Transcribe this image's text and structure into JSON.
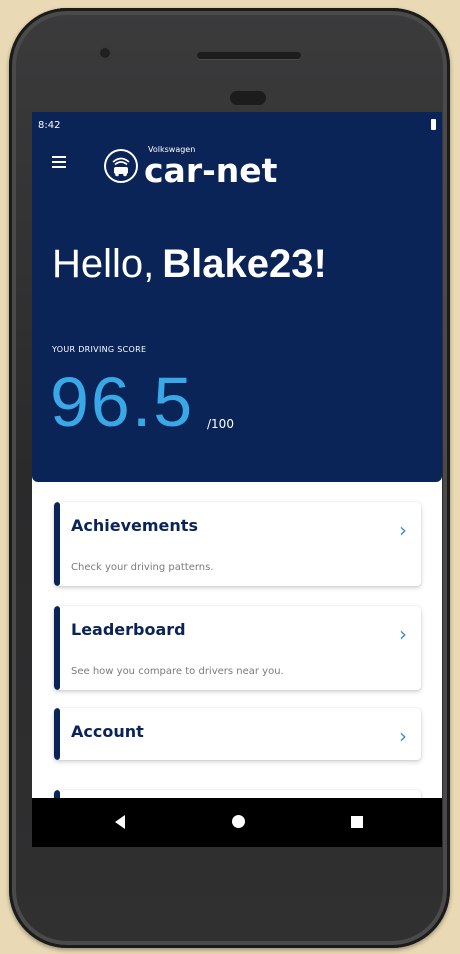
{
  "status_bar": {
    "time": "8:42"
  },
  "app": {
    "brand": "Volkswagen",
    "name": "car-net"
  },
  "greeting": {
    "hello": "Hello,",
    "username": "Blake23!"
  },
  "score": {
    "label": "YOUR DRIVING SCORE",
    "value": "96.5",
    "max": "/100"
  },
  "cards": [
    {
      "title": "Achievements",
      "description": "Check your driving patterns.",
      "chevron": "›"
    },
    {
      "title": "Leaderboard",
      "description": "See how you compare to drivers near you.",
      "chevron": "›"
    },
    {
      "title": "Account",
      "chevron": "›"
    }
  ],
  "icons": {
    "menu": "hamburger-menu-icon",
    "logo": "car-net-badge-icon",
    "battery": "battery-icon",
    "nav_back": "back-triangle-icon",
    "nav_home": "home-circle-icon",
    "nav_recent": "recent-square-icon"
  },
  "colors": {
    "header_bg": "#0b2458",
    "score_accent": "#39a8e6",
    "chevron": "#3a8fd6",
    "card_accent": "#0b2458"
  }
}
